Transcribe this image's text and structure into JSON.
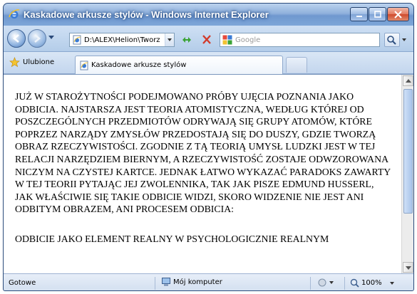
{
  "window": {
    "title": "Kaskadowe arkusze stylów - Windows Internet Explorer",
    "controls": {
      "minimize": "–",
      "maximize": "□",
      "close": "✕"
    }
  },
  "navigation": {
    "address": "D:\\ALEX\\Helion\\Tworz",
    "search_placeholder": "Google"
  },
  "favorites": {
    "label": "Ulubione"
  },
  "tabs": [
    {
      "label": "Kaskadowe arkusze stylów"
    }
  ],
  "document": {
    "paragraphs": [
      "JUŻ W STAROŻYTNOŚCI PODEJMOWANO PRÓBY UJĘCIA POZNANIA JAKO ODBICIA. NAJSTARSZA JEST TEORIA ATOMISTYCZNA, WEDŁUG KTÓREJ OD POSZCZEGÓLNYCH PRZEDMIOTÓW ODRYWAJĄ SIĘ GRUPY ATOMÓW, KTÓRE POPRZEZ NARZĄDY ZMYSŁÓW PRZEDOSTAJĄ SIĘ DO DUSZY, GDZIE TWORZĄ OBRAZ RZECZYWISTOŚCI. ZGODNIE Z TĄ TEORIĄ UMYSŁ LUDZKI JEST W TEJ RELACJI NARZĘDZIEM BIERNYM, A RZECZYWISTOŚĆ ZOSTAJE ODWZOROWANA NICZYM NA CZYSTEJ KARTCE. JEDNAK ŁATWO WYKAZAĆ PARADOKS ZAWARTY W TEJ TEORII PYTAJĄC JEJ ZWOLENNIKA, TAK JAK PISZE EDMUND HUSSERL, JAK WŁAŚCIWIE SIĘ TAKIE ODBICIE WIDZI, SKORO WIDZENIE NIE JEST ANI ODBITYM OBRAZEM, ANI PROCESEM ODBICIA:",
      "ODBICIE JAKO ELEMENT REALNY W PSYCHOLOGICZNIE REALNYM"
    ]
  },
  "status": {
    "text": "Gotowe",
    "zone": "Mój komputer",
    "zoom": "100%"
  }
}
